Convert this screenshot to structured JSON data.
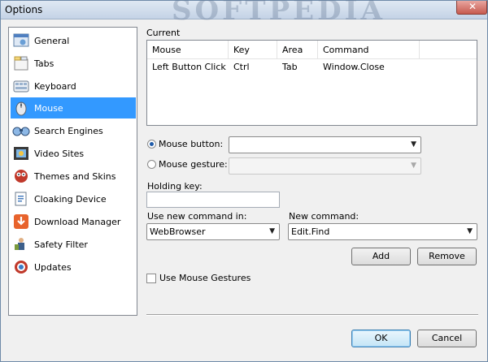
{
  "window": {
    "title": "Options",
    "close_glyph": "✕",
    "watermark": "SOFTPEDIA"
  },
  "sidebar": {
    "items": [
      {
        "label": "General",
        "icon": "general-icon"
      },
      {
        "label": "Tabs",
        "icon": "tabs-icon"
      },
      {
        "label": "Keyboard",
        "icon": "keyboard-icon"
      },
      {
        "label": "Mouse",
        "icon": "mouse-icon",
        "selected": true
      },
      {
        "label": "Search Engines",
        "icon": "search-engines-icon"
      },
      {
        "label": "Video Sites",
        "icon": "video-sites-icon"
      },
      {
        "label": "Themes and Skins",
        "icon": "themes-icon"
      },
      {
        "label": "Cloaking Device",
        "icon": "cloaking-icon"
      },
      {
        "label": "Download Manager",
        "icon": "download-icon"
      },
      {
        "label": "Safety Filter",
        "icon": "safety-icon"
      },
      {
        "label": "Updates",
        "icon": "updates-icon"
      }
    ],
    "selection_color": "#3399ff"
  },
  "current": {
    "label": "Current",
    "columns": [
      "Mouse",
      "Key",
      "Area",
      "Command"
    ],
    "rows": [
      [
        "Left Button Click",
        "Ctrl",
        "Tab",
        "Window.Close"
      ]
    ]
  },
  "mouse_button": {
    "label": "Mouse button:",
    "value": "",
    "selected": true
  },
  "mouse_gesture": {
    "label": "Mouse gesture:",
    "value": "",
    "selected": false,
    "disabled": true
  },
  "holding_key": {
    "label": "Holding key:",
    "value": ""
  },
  "use_new_command_in": {
    "label": "Use new command in:",
    "value": "WebBrowser"
  },
  "new_command": {
    "label": "New command:",
    "value": "Edit.Find"
  },
  "buttons": {
    "add": "Add",
    "remove": "Remove",
    "ok": "OK",
    "cancel": "Cancel"
  },
  "use_mouse_gestures": {
    "label": "Use Mouse Gestures",
    "checked": false
  },
  "dropdown_arrow": "▼"
}
